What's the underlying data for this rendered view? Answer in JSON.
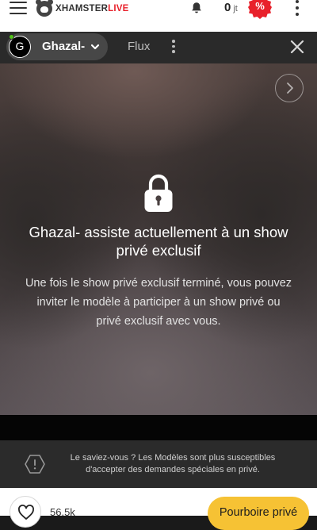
{
  "header": {
    "logo_primary": "XHAMSTER",
    "logo_accent": "LIVE",
    "token_balance": "0",
    "token_unit": "jt",
    "promo_symbol": "%",
    "brand_color": "#e8212b",
    "icons": [
      "menu-icon",
      "bell-icon",
      "promo-badge-icon",
      "more-vertical-icon"
    ]
  },
  "stream_bar": {
    "avatar_initial": "G",
    "model_name": "Ghazal-",
    "online_status_color": "#52c41a",
    "tab_flux": "Flux"
  },
  "video": {
    "title": "Ghazal- assiste actuellement à un show privé exclusif",
    "description": "Une fois le show privé exclusif terminé, vous pouvez inviter le modèle à participer à un show privé ou privé exclusif avec vous."
  },
  "tip_banner": {
    "text": "Le saviez-vous ? Les Modèles sont plus susceptibles d'accepter des demandes spéciales en privé."
  },
  "footer": {
    "favorites_count": "56.5k",
    "tip_button_label": "Pourboire privé",
    "tip_button_color": "#f6c234"
  }
}
